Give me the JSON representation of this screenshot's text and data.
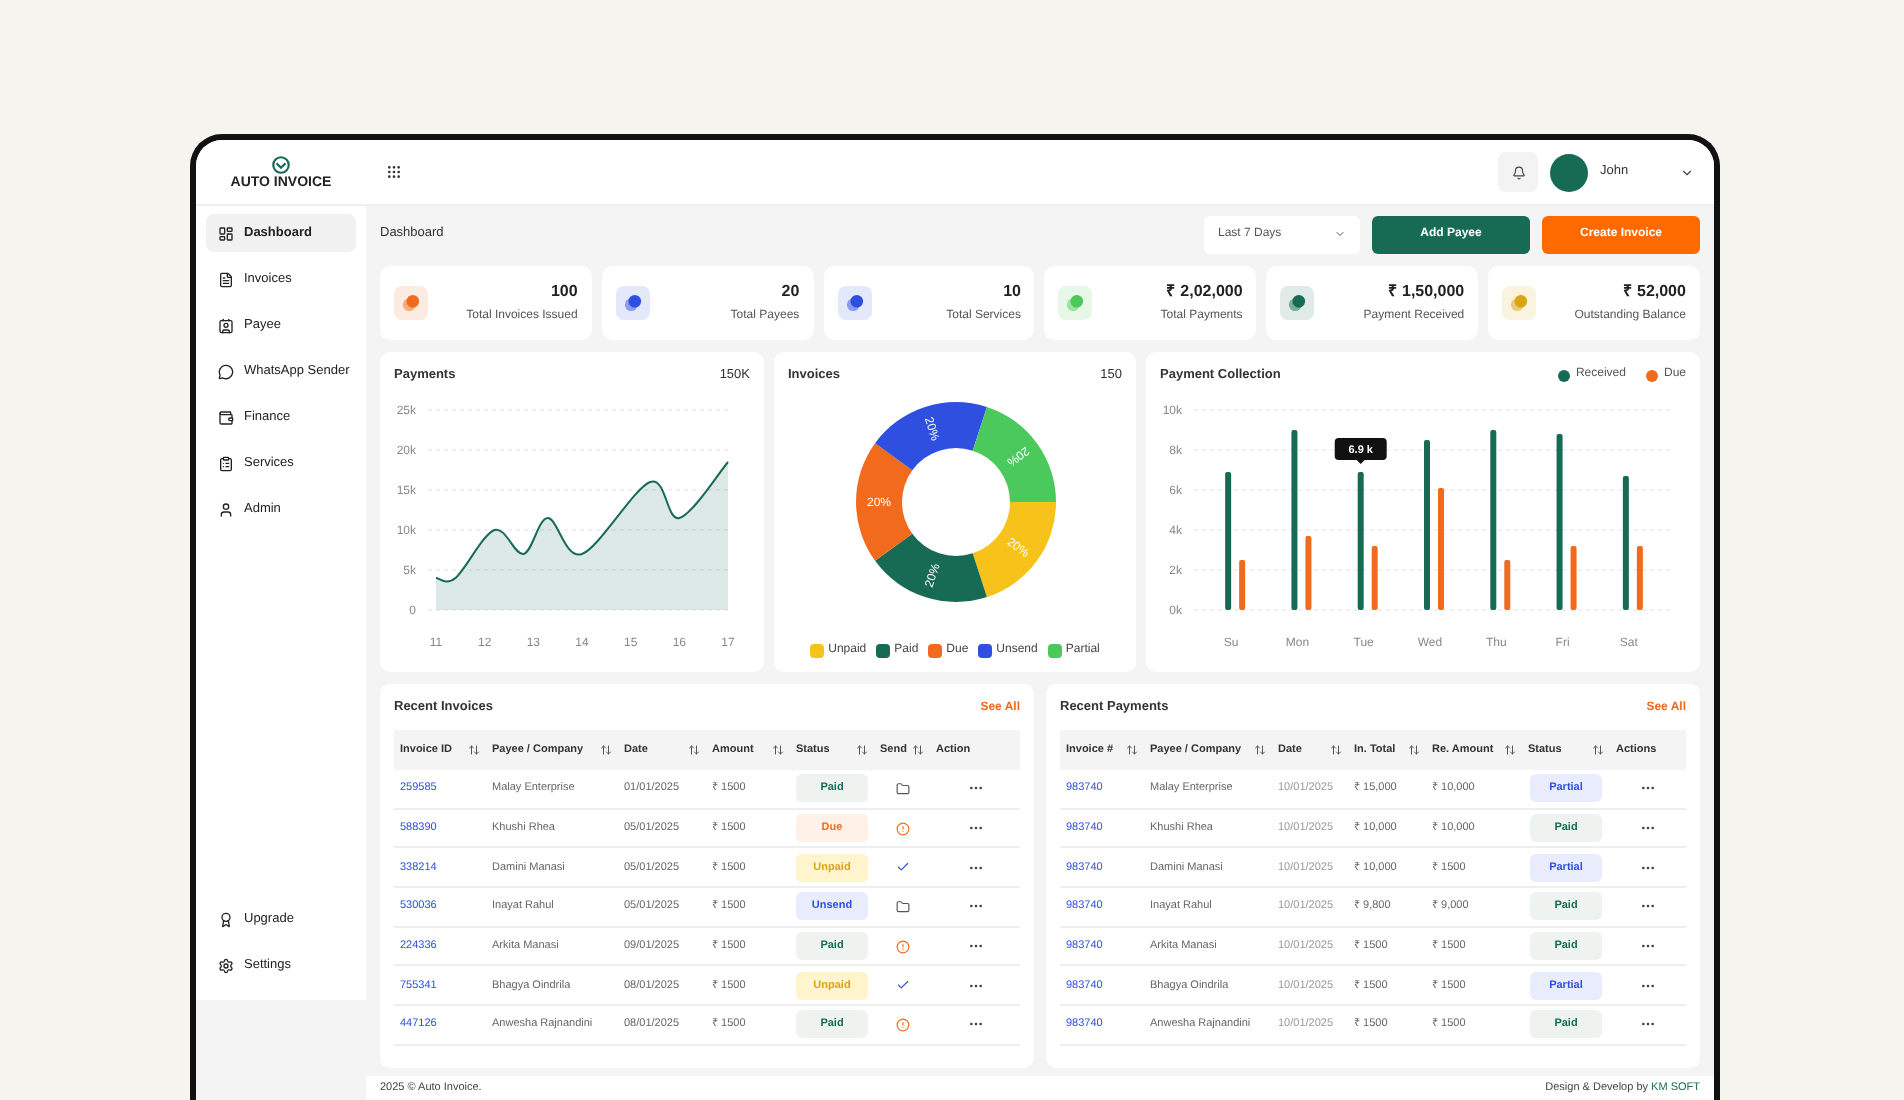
{
  "app": {
    "logo_text": "AUTO INVOICE"
  },
  "header": {
    "user_name": "John"
  },
  "sidebar": {
    "items": [
      {
        "label": "Dashboard",
        "selected": true
      },
      {
        "label": "Invoices",
        "selected": false
      },
      {
        "label": "Payee",
        "selected": false
      },
      {
        "label": "WhatsApp Sender",
        "selected": false
      },
      {
        "label": "Finance",
        "selected": false
      },
      {
        "label": "Services",
        "selected": false
      },
      {
        "label": "Admin",
        "selected": false
      }
    ],
    "bottom_items": [
      {
        "label": "Upgrade",
        "selected": false
      },
      {
        "label": "Settings",
        "selected": false
      }
    ]
  },
  "page": {
    "breadcrumb": "Dashboard",
    "range_select": "Last 7 Days",
    "buttons": [
      {
        "label": "Add Payee",
        "kind": "primary"
      },
      {
        "label": "Create Invoice",
        "kind": "accent"
      }
    ]
  },
  "stats": [
    {
      "value": "100",
      "label": "Total Invoices Issued",
      "color": "#f26a1b"
    },
    {
      "value": "20",
      "label": "Total Payees",
      "color": "#2f4fe0"
    },
    {
      "value": "10",
      "label": "Total Services",
      "color": "#2f4fe0"
    },
    {
      "value": "₹ 2,02,000",
      "label": "Total Payments",
      "color": "#4cc95c"
    },
    {
      "value": "₹ 1,50,000",
      "label": "Payment Received",
      "color": "#176b55"
    },
    {
      "value": "₹ 52,000",
      "label": "Outstanding Balance",
      "color": "#d9a514"
    }
  ],
  "charts": {
    "payments": {
      "title": "Payments",
      "total": "150K",
      "chart_data": {
        "type": "area",
        "x": [
          11,
          11.4,
          12.2,
          12.8,
          13.3,
          14,
          15.4,
          16,
          17
        ],
        "series": [
          {
            "color": "#176b55",
            "values": [
              4000,
              4000,
              10000,
              7000,
              11500,
              7000,
              16000,
              11500,
              18500
            ]
          }
        ],
        "grid": true,
        "xlim": [
          11,
          17
        ],
        "ylim": [
          0,
          25000
        ],
        "xticks": [
          11,
          12,
          13,
          14,
          15,
          16,
          17
        ],
        "yticks": [
          {
            "value": 0,
            "label": "0"
          },
          {
            "value": 5000,
            "label": "5k"
          },
          {
            "value": 10000,
            "label": "10k"
          },
          {
            "value": 15000,
            "label": "15k"
          },
          {
            "value": 20000,
            "label": "20k"
          },
          {
            "value": 25000,
            "label": "25k"
          }
        ]
      }
    },
    "invoices": {
      "title": "Invoices",
      "total": "150",
      "chart_data": {
        "type": "donut",
        "categories": [
          "Unpaid",
          "Paid",
          "Due",
          "Unsend",
          "Partial"
        ],
        "values": [
          20,
          20,
          20,
          20,
          20
        ],
        "colors": [
          "#f7c31a",
          "#176b55",
          "#f26a1b",
          "#2f4fe0",
          "#4cc95c"
        ],
        "value_labels": [
          "20%",
          "20%",
          "20%",
          "20%",
          "20%"
        ]
      }
    },
    "payment_collection": {
      "title": "Payment Collection",
      "chart_data": {
        "type": "bar",
        "categories": [
          "Su",
          "Mon",
          "Tue",
          "Wed",
          "Thu",
          "Fri",
          "Sat"
        ],
        "series": [
          {
            "name": "Received",
            "color": "#176b55",
            "values": [
              6900,
              9000,
              6900,
              8500,
              9000,
              8800,
              6700
            ]
          },
          {
            "name": "Due",
            "color": "#f26a1b",
            "values": [
              2500,
              3700,
              3200,
              6100,
              2500,
              3200,
              3200
            ]
          }
        ],
        "ylim": [
          0,
          10000
        ],
        "grid": true,
        "yticks": [
          {
            "value": 0,
            "label": "0k"
          },
          {
            "value": 2000,
            "label": "2k"
          },
          {
            "value": 4000,
            "label": "4k"
          },
          {
            "value": 6000,
            "label": "6k"
          },
          {
            "value": 8000,
            "label": "8k"
          },
          {
            "value": 10000,
            "label": "10k"
          }
        ],
        "annotations": [
          {
            "x": "Tue",
            "y": 6900,
            "text": "6.9 k"
          }
        ]
      }
    }
  },
  "recent_invoices": {
    "title": "Recent Invoices",
    "link": "See All",
    "columns": [
      {
        "label": "Invoice ID",
        "sortable": true
      },
      {
        "label": "Payee / Company",
        "sortable": true
      },
      {
        "label": "Date",
        "sortable": true
      },
      {
        "label": "Amount",
        "sortable": true
      },
      {
        "label": "Status",
        "sortable": true
      },
      {
        "label": "Send",
        "sortable": true
      },
      {
        "label": "Action",
        "sortable": false
      }
    ],
    "rows": [
      {
        "id": "259585",
        "payee": "Malay Enterprise",
        "date": "01/01/2025",
        "amount": "₹ 1500",
        "status": {
          "text": "Paid",
          "kind": "paid"
        },
        "send": {
          "kind": "folder"
        }
      },
      {
        "id": "588390",
        "payee": "Khushi Rhea",
        "date": "05/01/2025",
        "amount": "₹ 1500",
        "status": {
          "text": "Due",
          "kind": "due"
        },
        "send": {
          "kind": "alert"
        }
      },
      {
        "id": "338214",
        "payee": "Damini Manasi",
        "date": "05/01/2025",
        "amount": "₹ 1500",
        "status": {
          "text": "Unpaid",
          "kind": "unpaid"
        },
        "send": {
          "kind": "check"
        }
      },
      {
        "id": "530036",
        "payee": "Inayat Rahul",
        "date": "05/01/2025",
        "amount": "₹ 1500",
        "status": {
          "text": "Unsend",
          "kind": "unsend"
        },
        "send": {
          "kind": "folder"
        }
      },
      {
        "id": "224336",
        "payee": "Arkita Manasi",
        "date": "09/01/2025",
        "amount": "₹ 1500",
        "status": {
          "text": "Paid",
          "kind": "paid"
        },
        "send": {
          "kind": "alert"
        }
      },
      {
        "id": "755341",
        "payee": "Bhagya Oindrila",
        "date": "08/01/2025",
        "amount": "₹ 1500",
        "status": {
          "text": "Unpaid",
          "kind": "unpaid"
        },
        "send": {
          "kind": "check"
        }
      },
      {
        "id": "447126",
        "payee": "Anwesha Rajnandini",
        "date": "08/01/2025",
        "amount": "₹ 1500",
        "status": {
          "text": "Paid",
          "kind": "paid"
        },
        "send": {
          "kind": "alert"
        }
      }
    ]
  },
  "recent_payments": {
    "title": "Recent Payments",
    "link": "See All",
    "columns": [
      {
        "label": "Invoice #",
        "sortable": true
      },
      {
        "label": "Payee / Company",
        "sortable": true
      },
      {
        "label": "Date",
        "sortable": true
      },
      {
        "label": "In. Total",
        "sortable": true
      },
      {
        "label": "Re. Amount",
        "sortable": true
      },
      {
        "label": "Status",
        "sortable": true
      },
      {
        "label": "Actions",
        "sortable": false
      }
    ],
    "rows": [
      {
        "id": "983740",
        "payee": "Malay Enterprise",
        "date": "10/01/2025",
        "total": "₹ 15,000",
        "received": "₹ 10,000",
        "status": {
          "text": "Partial",
          "kind": "partial"
        }
      },
      {
        "id": "983740",
        "payee": "Khushi Rhea",
        "date": "10/01/2025",
        "total": "₹ 10,000",
        "received": "₹ 10,000",
        "status": {
          "text": "Paid",
          "kind": "paid"
        }
      },
      {
        "id": "983740",
        "payee": "Damini Manasi",
        "date": "10/01/2025",
        "total": "₹ 10,000",
        "received": "₹ 1500",
        "status": {
          "text": "Partial",
          "kind": "partial"
        }
      },
      {
        "id": "983740",
        "payee": "Inayat Rahul",
        "date": "10/01/2025",
        "total": "₹ 9,800",
        "received": "₹ 9,000",
        "status": {
          "text": "Paid",
          "kind": "paid"
        }
      },
      {
        "id": "983740",
        "payee": "Arkita Manasi",
        "date": "10/01/2025",
        "total": "₹ 1500",
        "received": "₹ 1500",
        "status": {
          "text": "Paid",
          "kind": "paid"
        }
      },
      {
        "id": "983740",
        "payee": "Bhagya Oindrila",
        "date": "10/01/2025",
        "total": "₹ 1500",
        "received": "₹ 1500",
        "status": {
          "text": "Partial",
          "kind": "partial"
        }
      },
      {
        "id": "983740",
        "payee": "Anwesha Rajnandini",
        "date": "10/01/2025",
        "total": "₹ 1500",
        "received": "₹ 1500",
        "status": {
          "text": "Paid",
          "kind": "paid"
        }
      }
    ]
  },
  "footer": {
    "copyright": "2025 © Auto Invoice.",
    "credit": "Design & Develop by",
    "credit_brand": "KM SOFT"
  }
}
